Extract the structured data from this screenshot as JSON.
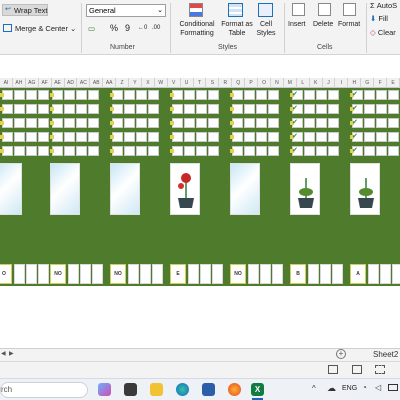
{
  "ribbon": {
    "wrap_text": "Wrap Text",
    "merge_center": "Merge & Center",
    "number_format": "General",
    "percent_symbol": "%",
    "comma_symbol": "9",
    "conditional_formatting": "Conditional Formatting",
    "format_as_table": "Format as Table",
    "cell_styles": "Cell Styles",
    "insert": "Insert",
    "delete": "Delete",
    "format": "Format",
    "autosum": "AutoS",
    "fill": "Fill",
    "clear": "Clear",
    "section_number": "Number",
    "section_styles": "Styles",
    "section_cells": "Cells"
  },
  "columns": [
    "AI",
    "AH",
    "AG",
    "AF",
    "AE",
    "AD",
    "AC",
    "AB",
    "AA",
    "Z",
    "Y",
    "X",
    "W",
    "V",
    "U",
    "T",
    "S",
    "R",
    "Q",
    "P",
    "O",
    "N",
    "M",
    "L",
    "K",
    "J",
    "I",
    "H",
    "G",
    "F",
    "E"
  ],
  "cards": [
    {
      "type": "ice"
    },
    {
      "type": "ice"
    },
    {
      "type": "ice"
    },
    {
      "type": "rose"
    },
    {
      "type": "ice"
    },
    {
      "type": "plant"
    },
    {
      "type": "plant"
    }
  ],
  "labels": [
    "O",
    "NO",
    "NO",
    "E",
    "NO",
    "B",
    "A"
  ],
  "sheet_tab": "Sheet2",
  "search_placeholder": "rch",
  "lang": "ENG",
  "colors": {
    "green": "#4e7b2c",
    "gold": "#e6d24a",
    "excel": "#107c41"
  }
}
